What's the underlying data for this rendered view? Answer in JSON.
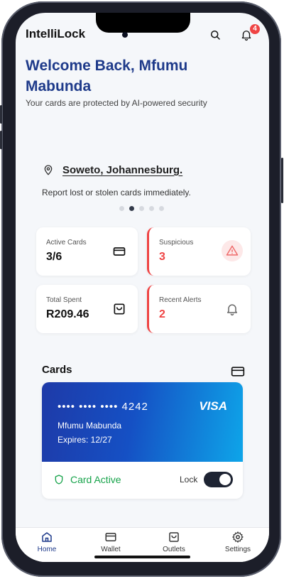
{
  "header": {
    "app_title": "IntelliLock",
    "notification_count": "4",
    "search_icon": "search-icon",
    "bell_icon": "bell-icon"
  },
  "hero": {
    "title": "Welcome Back, Mfumu Mabunda",
    "subtitle": "Your cards are protected by AI-powered security"
  },
  "location": {
    "text": "Soweto, Johannesburg.",
    "message": "Report lost or stolen cards immediately.",
    "carousel_active_index": 1,
    "carousel_count": 5
  },
  "stats": [
    {
      "label": "Active Cards",
      "value": "3/6",
      "icon": "credit-card-icon",
      "alert": false
    },
    {
      "label": "Suspicious",
      "value": "3",
      "icon": "warning-icon",
      "alert": true
    },
    {
      "label": "Total Spent",
      "value": "R209.46",
      "icon": "shopping-bag-icon",
      "alert": false
    },
    {
      "label": "Recent Alerts",
      "value": "2",
      "icon": "bell-icon",
      "alert": true
    }
  ],
  "cards": {
    "title": "Cards",
    "card": {
      "number": "•••• •••• •••• 4242",
      "brand": "VISA",
      "holder": "Mfumu Mabunda",
      "expires": "Expires: 12/27"
    },
    "status": "Card Active",
    "lock_label": "Lock",
    "locked": true
  },
  "tabs": [
    {
      "label": "Home",
      "icon": "home-icon",
      "active": true
    },
    {
      "label": "Wallet",
      "icon": "wallet-icon",
      "active": false
    },
    {
      "label": "Outlets",
      "icon": "shopping-bag-icon",
      "active": false
    },
    {
      "label": "Settings",
      "icon": "gear-icon",
      "active": false
    }
  ],
  "colors": {
    "brand": "#1e3a8a",
    "alert": "#ef4444",
    "success": "#16a34a"
  }
}
